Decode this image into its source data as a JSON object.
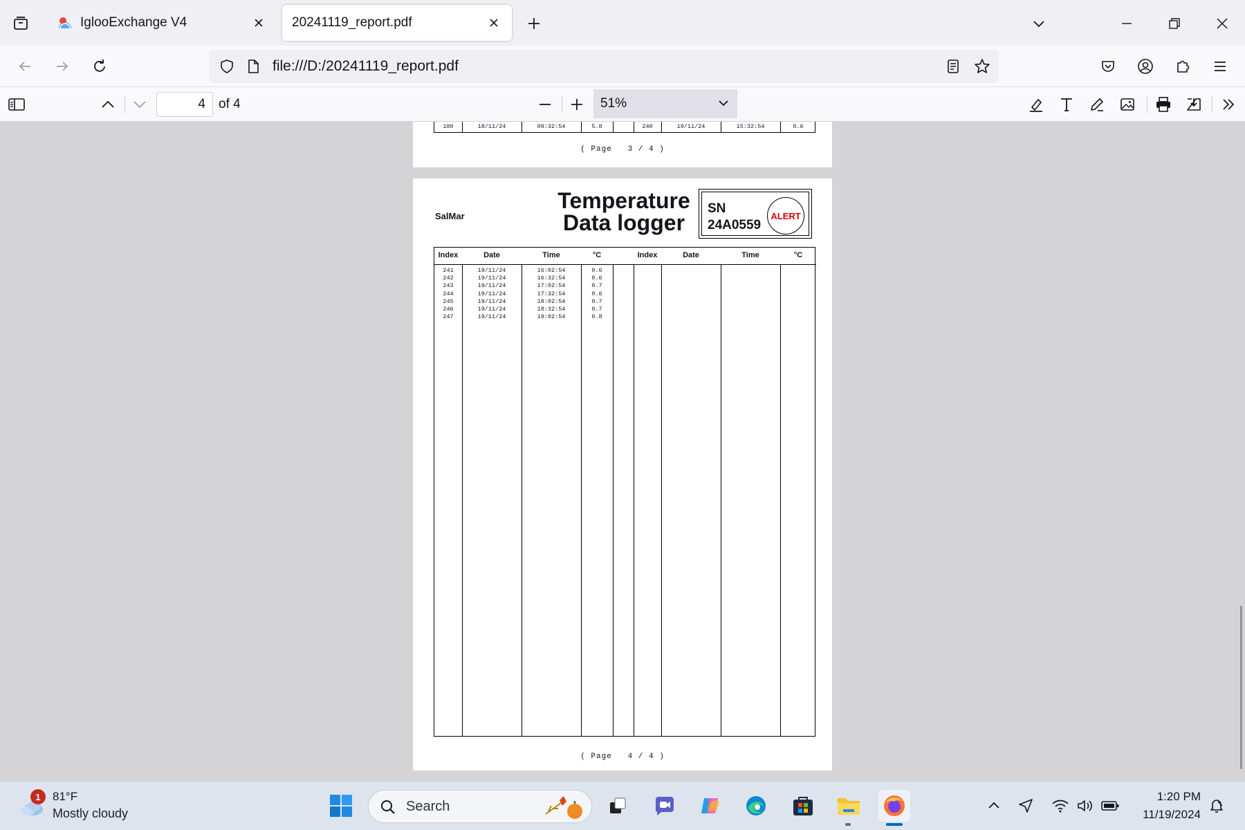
{
  "tabs": [
    {
      "title": "IglooExchange V4",
      "active": false
    },
    {
      "title": "20241119_report.pdf",
      "active": true
    }
  ],
  "navbar": {
    "url": "file:///D:/20241119_report.pdf"
  },
  "pdf_toolbar": {
    "page_number": "4",
    "page_total": "of 4",
    "zoom": "51%"
  },
  "document": {
    "page3": {
      "row": {
        "index_left": "180",
        "date_left": "18/11/24",
        "time_left": "09:32:54",
        "temp_left": "5.8",
        "index_right": "240",
        "date_right": "19/11/24",
        "time_right": "15:32:54",
        "temp_right": "0.6"
      },
      "footer": "( Page   3 / 4 )"
    },
    "page4": {
      "company": "SalMar",
      "title_line1": "Temperature",
      "title_line2": "Data logger",
      "sn_label": "SN",
      "sn_value": "24A0559",
      "alert": "ALERT",
      "headers": [
        "Index",
        "Date",
        "Time",
        "°C",
        "Index",
        "Date",
        "Time",
        "°C"
      ],
      "rows": [
        {
          "index": "241",
          "date": "19/11/24",
          "time": "16:02:54",
          "temp": "0.6"
        },
        {
          "index": "242",
          "date": "19/11/24",
          "time": "16:32:54",
          "temp": "0.6"
        },
        {
          "index": "243",
          "date": "19/11/24",
          "time": "17:02:54",
          "temp": "0.7"
        },
        {
          "index": "244",
          "date": "19/11/24",
          "time": "17:32:54",
          "temp": "0.6"
        },
        {
          "index": "245",
          "date": "19/11/24",
          "time": "18:02:54",
          "temp": "0.7"
        },
        {
          "index": "246",
          "date": "19/11/24",
          "time": "18:32:54",
          "temp": "0.7"
        },
        {
          "index": "247",
          "date": "19/11/24",
          "time": "19:02:54",
          "temp": "0.8"
        }
      ],
      "footer": "( Page   4 / 4 )"
    }
  },
  "taskbar": {
    "weather": {
      "badge": "1",
      "temp": "81°F",
      "desc": "Mostly cloudy"
    },
    "search_placeholder": "Search",
    "clock": {
      "time": "1:20 PM",
      "date": "11/19/2024"
    }
  },
  "colors": {
    "alert_red": "#e00000",
    "accent": "#0067c0",
    "firefox_orange": "#ff7139"
  }
}
